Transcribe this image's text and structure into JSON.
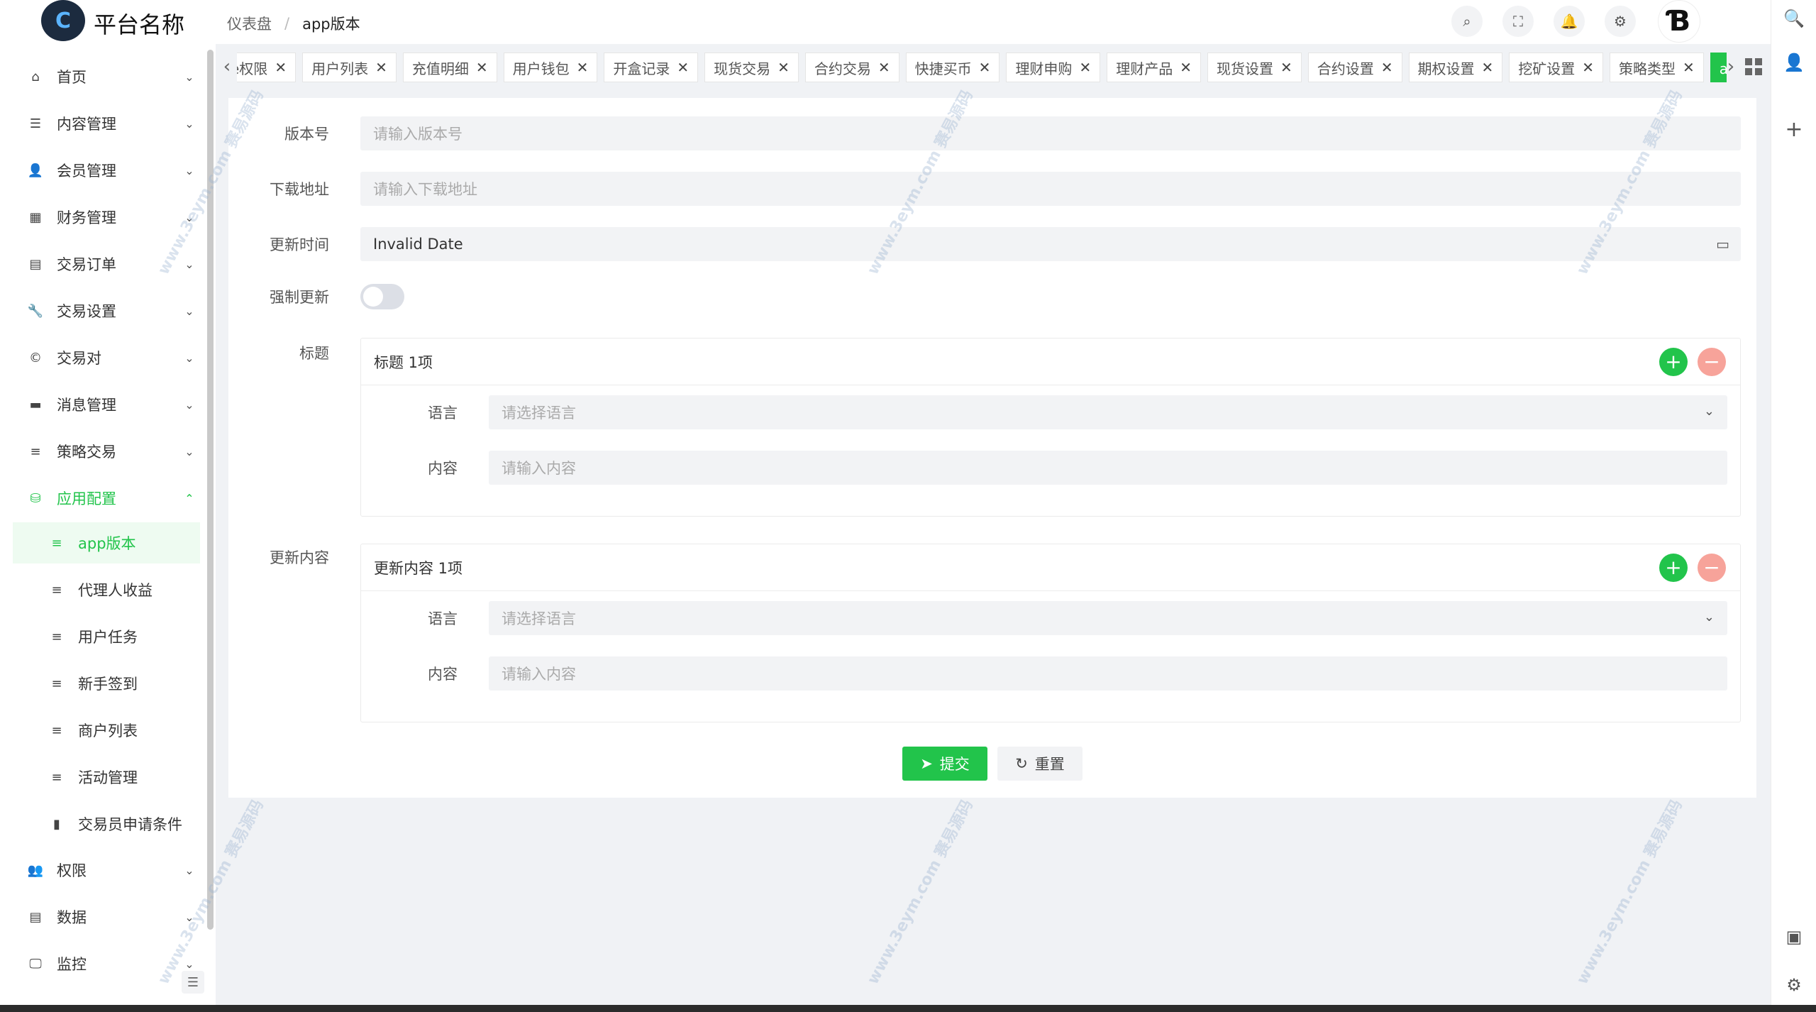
{
  "header": {
    "logo_text": "C",
    "platform_name": "平台名称",
    "breadcrumb": {
      "home": "仪表盘",
      "sep": "/",
      "current": "app版本"
    },
    "brand_mark": "Ɓ"
  },
  "icons": {
    "search": "⌕",
    "fullscreen": "⛶",
    "bell": "🔔",
    "gear": "⚙",
    "rail_search": "🔍",
    "rail_user": "👤",
    "rail_plus": "+",
    "rail_screen": "▣",
    "rail_settings": "⚙"
  },
  "sidebar": {
    "items": [
      {
        "label": "首页",
        "icon": "⌂",
        "arrow": "⌄"
      },
      {
        "label": "内容管理",
        "icon": "☰",
        "arrow": "⌄"
      },
      {
        "label": "会员管理",
        "icon": "👤",
        "arrow": "⌄"
      },
      {
        "label": "财务管理",
        "icon": "▦",
        "arrow": "⌄"
      },
      {
        "label": "交易订单",
        "icon": "▤",
        "arrow": "⌄"
      },
      {
        "label": "交易设置",
        "icon": "🔧",
        "arrow": "⌄"
      },
      {
        "label": "交易对",
        "icon": "©",
        "arrow": "⌄"
      },
      {
        "label": "消息管理",
        "icon": "▬",
        "arrow": "⌄"
      },
      {
        "label": "策略交易",
        "icon": "≡",
        "arrow": "⌄"
      },
      {
        "label": "应用配置",
        "icon": "⛁",
        "arrow": "⌃"
      }
    ],
    "sub_items": [
      {
        "label": "app版本",
        "icon": "≡"
      },
      {
        "label": "代理人收益",
        "icon": "≡"
      },
      {
        "label": "用户任务",
        "icon": "≡"
      },
      {
        "label": "新手签到",
        "icon": "≡"
      },
      {
        "label": "商户列表",
        "icon": "≡"
      },
      {
        "label": "活动管理",
        "icon": "≡"
      },
      {
        "label": "交易员申请条件",
        "icon": "▮"
      }
    ],
    "bottom_items": [
      {
        "label": "权限",
        "icon": "👥",
        "arrow": "⌄"
      },
      {
        "label": "数据",
        "icon": "▤",
        "arrow": "⌄"
      },
      {
        "label": "监控",
        "icon": "🖵",
        "arrow": "⌄"
      }
    ],
    "collapse_icon": "☰"
  },
  "tabs": {
    "left_arrow": "‹",
    "right_arrow": "›",
    "close": "✕",
    "items": [
      "e权限",
      "用户列表",
      "充值明细",
      "用户钱包",
      "开盒记录",
      "现货交易",
      "合约交易",
      "快捷买币",
      "理财申购",
      "理财产品",
      "现货设置",
      "合约设置",
      "期权设置",
      "挖矿设置",
      "策略类型",
      "app版本"
    ]
  },
  "form": {
    "version": {
      "label": "版本号",
      "placeholder": "请输入版本号"
    },
    "download": {
      "label": "下载地址",
      "placeholder": "请输入下载地址"
    },
    "update_time": {
      "label": "更新时间",
      "value": "Invalid Date",
      "icon": "▭"
    },
    "force_update": {
      "label": "强制更新"
    },
    "title": {
      "label": "标题",
      "group_header": "标题 1项",
      "add": "+",
      "remove": "−",
      "lang_label": "语言",
      "lang_placeholder": "请选择语言",
      "select_arrow": "⌄",
      "content_label": "内容",
      "content_placeholder": "请输入内容"
    },
    "update_content": {
      "label": "更新内容",
      "group_header": "更新内容 1项",
      "add": "+",
      "remove": "−",
      "lang_label": "语言",
      "lang_placeholder": "请选择语言",
      "select_arrow": "⌄",
      "content_label": "内容",
      "content_placeholder": "请输入内容"
    },
    "submit": {
      "icon": "➤",
      "label": "提交"
    },
    "reset": {
      "icon": "↻",
      "label": "重置"
    }
  },
  "watermark": {
    "text": "www.3eym.com 赛易源码"
  },
  "colors": {
    "accent": "#22c44b",
    "remove": "#f7a39a"
  }
}
